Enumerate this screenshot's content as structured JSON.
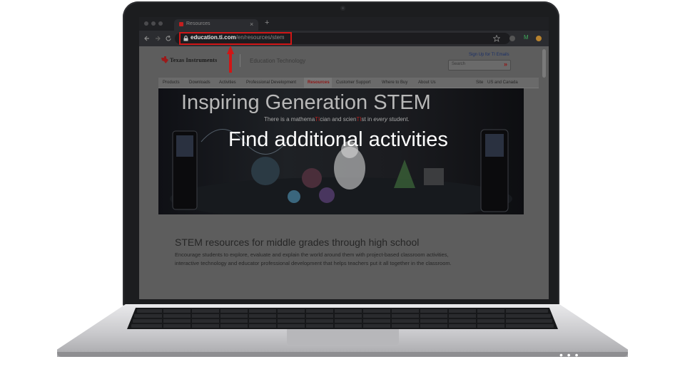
{
  "browser": {
    "tab_title": "Resources",
    "tab_close": "×",
    "new_tab": "+",
    "url_host": "education.ti.com",
    "url_path": "/en/resources/stem",
    "profile_letter": "M"
  },
  "site": {
    "logo": "Texas Instruments",
    "section_title": "Education Technology",
    "signup_link": "Sign Up for TI Emails",
    "search_placeholder": "Search",
    "search_button": "»",
    "nav": [
      "Products",
      "Downloads",
      "Activities",
      "Professional Development",
      "Resources",
      "Customer Support",
      "Where to Buy",
      "About Us"
    ],
    "site_label": "Site",
    "site_value": "US and Canada"
  },
  "hero": {
    "title": "Inspiring Generation STEM",
    "subtitle_parts": [
      "There is a mathema",
      "TI",
      "cian and scien",
      "TI",
      "st in ",
      "every",
      " student."
    ]
  },
  "overlay": {
    "caption": "Find additional activities"
  },
  "content": {
    "heading": "STEM resources for middle grades through high school",
    "body_line1": "Encourage students to explore, evaluate and explain the world around them with project-based classroom activities,",
    "body_line2": "interactive technology and educator professional development that helps teachers put it all together in the classroom."
  },
  "laptop": {
    "menu_dots": "• • •"
  },
  "colors": {
    "highlight": "#d01616",
    "ti_red": "#c41f1f",
    "active_nav": "#b01a1a"
  }
}
